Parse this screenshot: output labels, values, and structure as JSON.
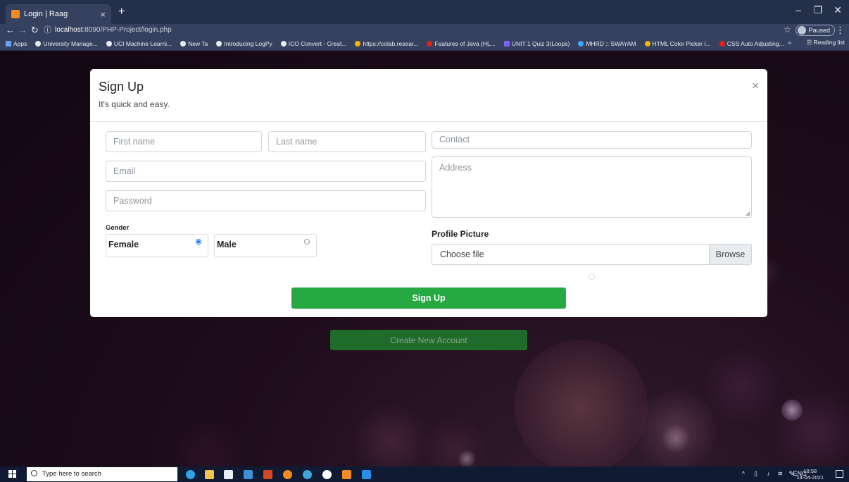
{
  "browser": {
    "tab_title": "Login | Raag",
    "tab_close": "×",
    "new_tab": "+",
    "url_host": "localhost",
    "url_path": ":8090/PHP-Project/login.php",
    "profile_status": "Paused",
    "bookmarks": [
      {
        "label": "Apps",
        "color": "#6aa0f0"
      },
      {
        "label": "University Manage...",
        "color": "#e8ecf4"
      },
      {
        "label": "UCI Machine Learni...",
        "color": "#e8ecf4"
      },
      {
        "label": "New Ta",
        "color": "#e8ecf4"
      },
      {
        "label": "Introducing LogPy",
        "color": "#e8ecf4"
      },
      {
        "label": "ICO Convert - Creat...",
        "color": "#e8ecf4"
      },
      {
        "label": "https://colab.resear...",
        "color": "#f5b400"
      },
      {
        "label": "Features of Java (HL...",
        "color": "#e62117"
      },
      {
        "label": "UNIT 1 Quiz 3(Loops)",
        "color": "#7b61ff"
      },
      {
        "label": "MHRD :: SWAYAM",
        "color": "#3da9f5"
      },
      {
        "label": "HTML Color Picker I...",
        "color": "#f5b400"
      },
      {
        "label": "CSS Auto Adjusting...",
        "color": "#e62117"
      }
    ],
    "overflow": "»",
    "reading_list": "Reading list"
  },
  "modal": {
    "title": "Sign Up",
    "subtitle": "It's quick and easy.",
    "close": "×",
    "first_name_placeholder": "First name",
    "last_name_placeholder": "Last name",
    "email_placeholder": "Email",
    "password_placeholder": "Password",
    "contact_placeholder": "Contact",
    "address_placeholder": "Address",
    "gender_label": "Gender",
    "gender_options": [
      {
        "label": "Female",
        "selected": true
      },
      {
        "label": "Male",
        "selected": false
      }
    ],
    "profile_picture_label": "Profile Picture",
    "file_placeholder": "Choose file",
    "browse_label": "Browse",
    "submit_label": "Sign Up"
  },
  "page": {
    "create_account_label": "Create New Account"
  },
  "taskbar": {
    "search_placeholder": "Type here to search",
    "language": "ENG",
    "time": "18:58",
    "date": "14-04-2021"
  },
  "colors": {
    "accent_green": "#26a843",
    "browser_chrome": "#35415e",
    "taskbar": "#101a33"
  }
}
